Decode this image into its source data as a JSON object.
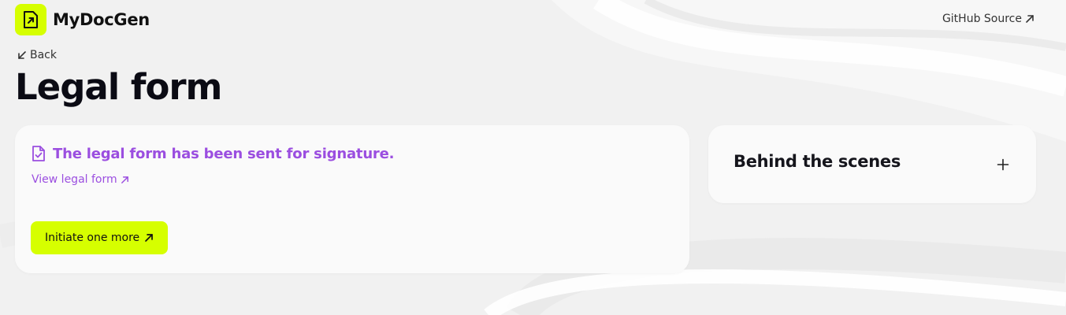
{
  "header": {
    "brand_name": "MyDocGen",
    "github_label": "GitHub Source"
  },
  "nav": {
    "back_label": "Back"
  },
  "page": {
    "title": "Legal form"
  },
  "status_card": {
    "message": "The legal form has been sent for signature.",
    "view_link_label": "View legal form",
    "initiate_button_label": "Initiate one more"
  },
  "side_card": {
    "title": "Behind the scenes"
  },
  "colors": {
    "accent_lime": "#d6ff00",
    "accent_purple": "#9b4ee0",
    "background": "#f1f1f1",
    "card": "#fafafa"
  },
  "icons": {
    "logo": "arrow-up-right-document-icon",
    "github": "arrow-up-right-icon",
    "back": "arrow-down-left-icon",
    "success": "document-check-icon",
    "view": "arrow-up-right-icon",
    "initiate": "arrow-up-right-icon",
    "toggle": "plus-icon"
  }
}
